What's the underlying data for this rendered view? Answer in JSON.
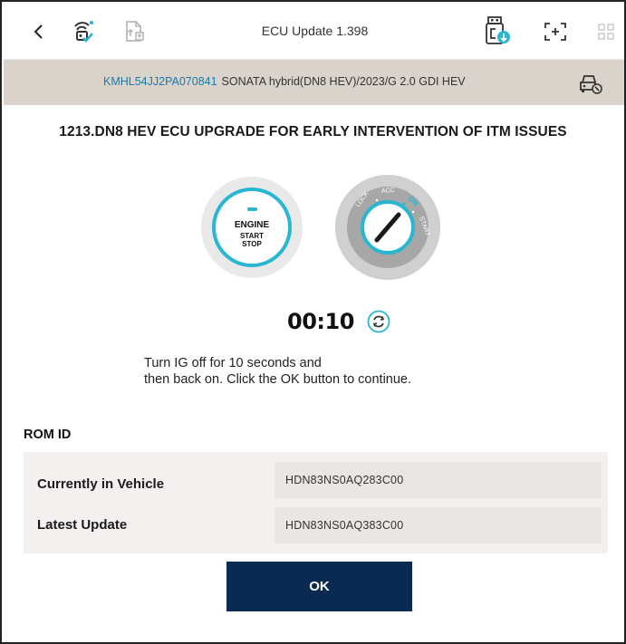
{
  "header": {
    "title": "ECU Update 1.398"
  },
  "vehicle": {
    "vin": "KMHL54JJ2PA070841",
    "description": "SONATA hybrid(DN8 HEV)/2023/G 2.0 GDI HEV"
  },
  "procedure": {
    "heading": "1213.DN8 HEV ECU UPGRADE FOR EARLY INTERVENTION OF ITM ISSUES",
    "engine_button": {
      "line1": "ENGINE",
      "line2": "START",
      "line3": "STOP"
    },
    "ignition_positions": [
      "LOCK",
      "ACC",
      "ON",
      "START"
    ],
    "timer": "00:10",
    "instruction_line1": "Turn IG off for 10 seconds and",
    "instruction_line2": "then back on. Click the OK button to continue."
  },
  "rom": {
    "title": "ROM ID",
    "rows": [
      {
        "label": "Currently in Vehicle",
        "value": "HDN83NS0AQ283C00"
      },
      {
        "label": "Latest Update",
        "value": "HDN83NS0AQ383C00"
      }
    ]
  },
  "ok_label": "OK",
  "colors": {
    "accent": "#29b6d2",
    "vin": "#1c7aa5",
    "vehicle_bar": "#d9d3cb",
    "ok_button": "#0b2a52"
  },
  "icons": [
    "chevron-left-icon",
    "vci-connection-icon",
    "document-upload-icon",
    "usb-icon",
    "capture-icon",
    "grid-icon",
    "car-settings-icon",
    "refresh-icon"
  ]
}
